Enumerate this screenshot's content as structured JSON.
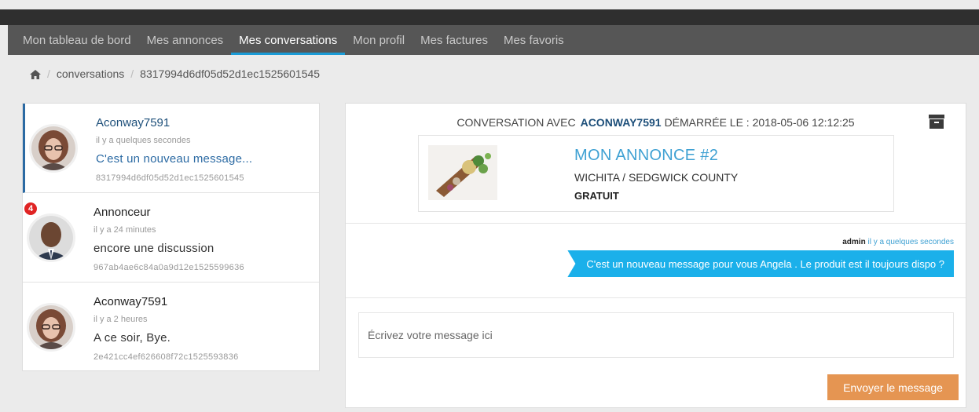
{
  "nav": {
    "items": [
      {
        "label": "Mon tableau de bord"
      },
      {
        "label": "Mes annonces"
      },
      {
        "label": "Mes conversations"
      },
      {
        "label": "Mon profil"
      },
      {
        "label": "Mes factures"
      },
      {
        "label": "Mes favoris"
      }
    ],
    "active_index": 2
  },
  "breadcrumb": {
    "home_icon": "home-icon",
    "items": [
      "conversations",
      "8317994d6df05d52d1ec1525601545"
    ]
  },
  "conversations": [
    {
      "name": "Aconway7591",
      "time": "il y a quelques secondes",
      "message": "C'est un nouveau message...",
      "id": "8317994d6df05d52d1ec1525601545",
      "badge": ""
    },
    {
      "name": "Annonceur",
      "time": "il y a 24 minutes",
      "message": "encore une discussion",
      "id": "967ab4ae6c84a0a9d12e1525599636",
      "badge": "4"
    },
    {
      "name": "Aconway7591",
      "time": "il y a 2 heures",
      "message": "A ce soir, Bye.",
      "id": "2e421cc4ef626608f72c1525593836",
      "badge": ""
    }
  ],
  "panel": {
    "header_prefix": "CONVERSATION AVEC",
    "header_name": "ACONWAY7591",
    "header_suffix": "DÉMARRÉE LE : 2018-05-06 12:12:25",
    "archive_icon": "archive-icon",
    "annonce": {
      "title": "MON ANNONCE #2",
      "location": "WICHITA / SEDGWICK COUNTY",
      "price": "GRATUIT"
    },
    "message": {
      "author": "admin",
      "time": "il y a quelques secondes",
      "text": "C'est un nouveau message pour vous Angela . Le produit est il toujours dispo ?"
    },
    "input_placeholder": "Écrivez votre message ici",
    "send_label": "Envoyer le message"
  },
  "colors": {
    "accent": "#1a9bd6",
    "bubble": "#1bb0ea",
    "send_button": "#e59552",
    "badge": "#e02424"
  }
}
